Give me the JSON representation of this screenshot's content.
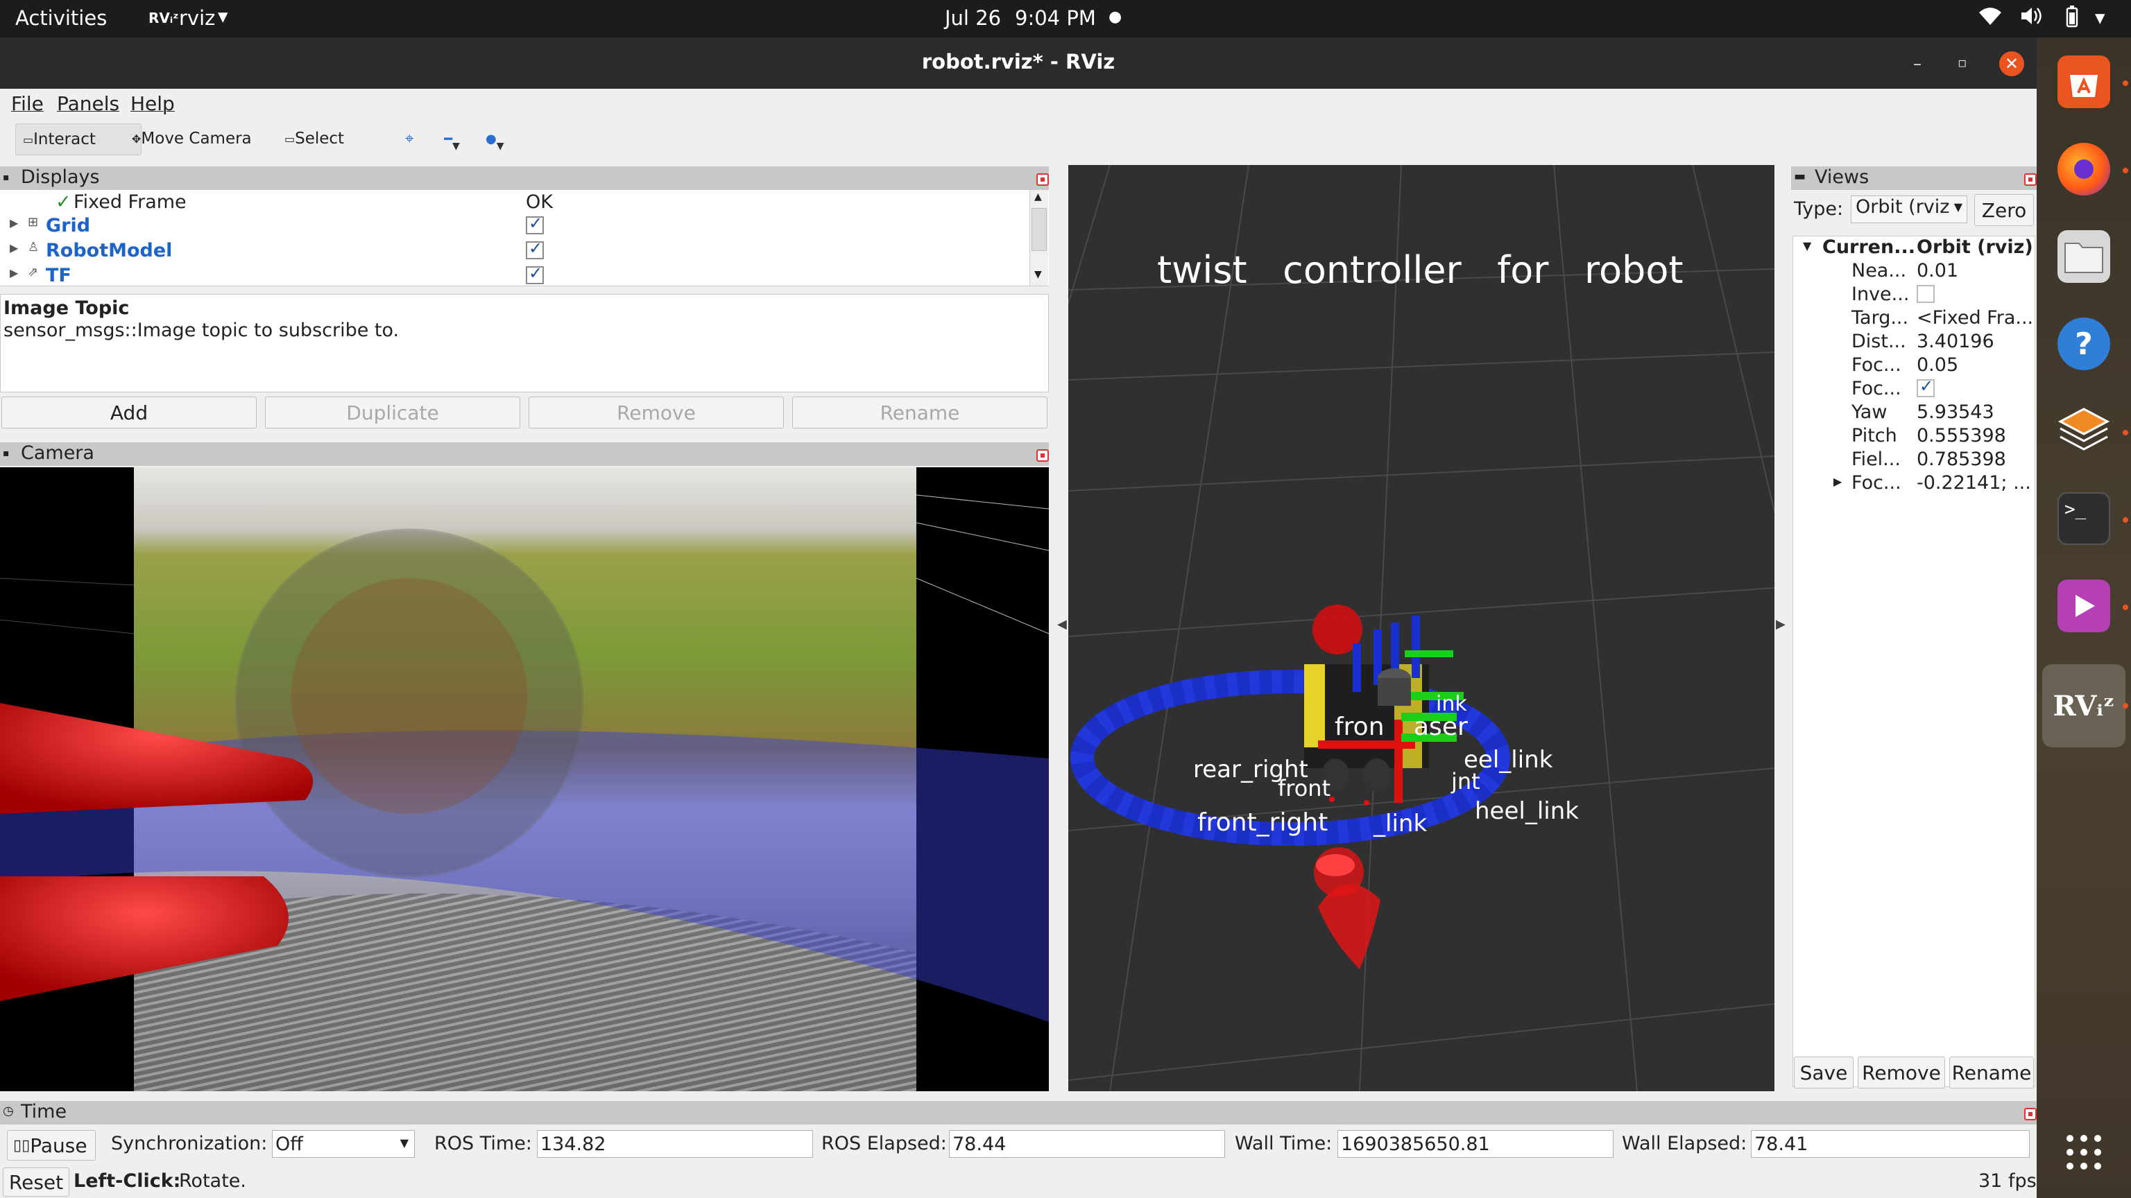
{
  "topbar": {
    "activities": "Activities",
    "app_name": "rviz",
    "date": "Jul 26",
    "time": "9:04 PM"
  },
  "window": {
    "title": "robot.rviz* - RViz"
  },
  "menu": {
    "file": "File",
    "panels": "Panels",
    "help": "Help"
  },
  "toolbar": {
    "interact": "Interact",
    "move_camera": "Move Camera",
    "select": "Select"
  },
  "displays": {
    "title": "Displays",
    "fixed_frame_label": "Fixed Frame",
    "fixed_frame_value": "OK",
    "items": [
      {
        "label": "Grid",
        "checked": true
      },
      {
        "label": "RobotModel",
        "checked": true
      },
      {
        "label": "TF",
        "checked": true
      }
    ],
    "description_title": "Image Topic",
    "description_text": "sensor_msgs::Image topic to subscribe to.",
    "buttons": {
      "add": "Add",
      "duplicate": "Duplicate",
      "remove": "Remove",
      "rename": "Rename"
    }
  },
  "camera": {
    "title": "Camera"
  },
  "viewport": {
    "overlay_text": "twist   controller   for   robot",
    "tf_labels": [
      "fron",
      "aser",
      "rear_right",
      "front_right",
      "eel_link",
      "heel_link",
      "_link",
      "front",
      "jnt",
      "ink"
    ]
  },
  "views": {
    "title": "Views",
    "type_label": "Type:",
    "type_value": "Orbit (rviz",
    "zero": "Zero",
    "header_name": "Curren...",
    "header_value": "Orbit (rviz)",
    "props": [
      {
        "name": "Nea...",
        "value": "0.01"
      },
      {
        "name": "Inve...",
        "value": ""
      },
      {
        "name": "Targ...",
        "value": "<Fixed Fra..."
      },
      {
        "name": "Dist...",
        "value": "3.40196"
      },
      {
        "name": "Foc...",
        "value": "0.05"
      },
      {
        "name": "Foc...",
        "value": ""
      },
      {
        "name": "Yaw",
        "value": "5.93543"
      },
      {
        "name": "Pitch",
        "value": "0.555398"
      },
      {
        "name": "Fiel...",
        "value": "0.785398"
      },
      {
        "name": "Foc...",
        "value": "-0.22141; ..."
      }
    ],
    "buttons": {
      "save": "Save",
      "remove": "Remove",
      "rename": "Rename"
    }
  },
  "time": {
    "title": "Time",
    "pause": "Pause",
    "sync_label": "Synchronization:",
    "sync_value": "Off",
    "ros_time_label": "ROS Time:",
    "ros_time": "134.82",
    "ros_elapsed_label": "ROS Elapsed:",
    "ros_elapsed": "78.44",
    "wall_time_label": "Wall Time:",
    "wall_time": "1690385650.81",
    "wall_elapsed_label": "Wall Elapsed:",
    "wall_elapsed": "78.41"
  },
  "status": {
    "reset": "Reset",
    "hint_bold": "Left-Click:",
    "hint": "Rotate.",
    "fps": "31 fps"
  },
  "colors": {
    "accent": "#e95420",
    "grid_bg": "#303030",
    "robot_ring": "#1a2fd0",
    "tf_red": "#e01010"
  }
}
